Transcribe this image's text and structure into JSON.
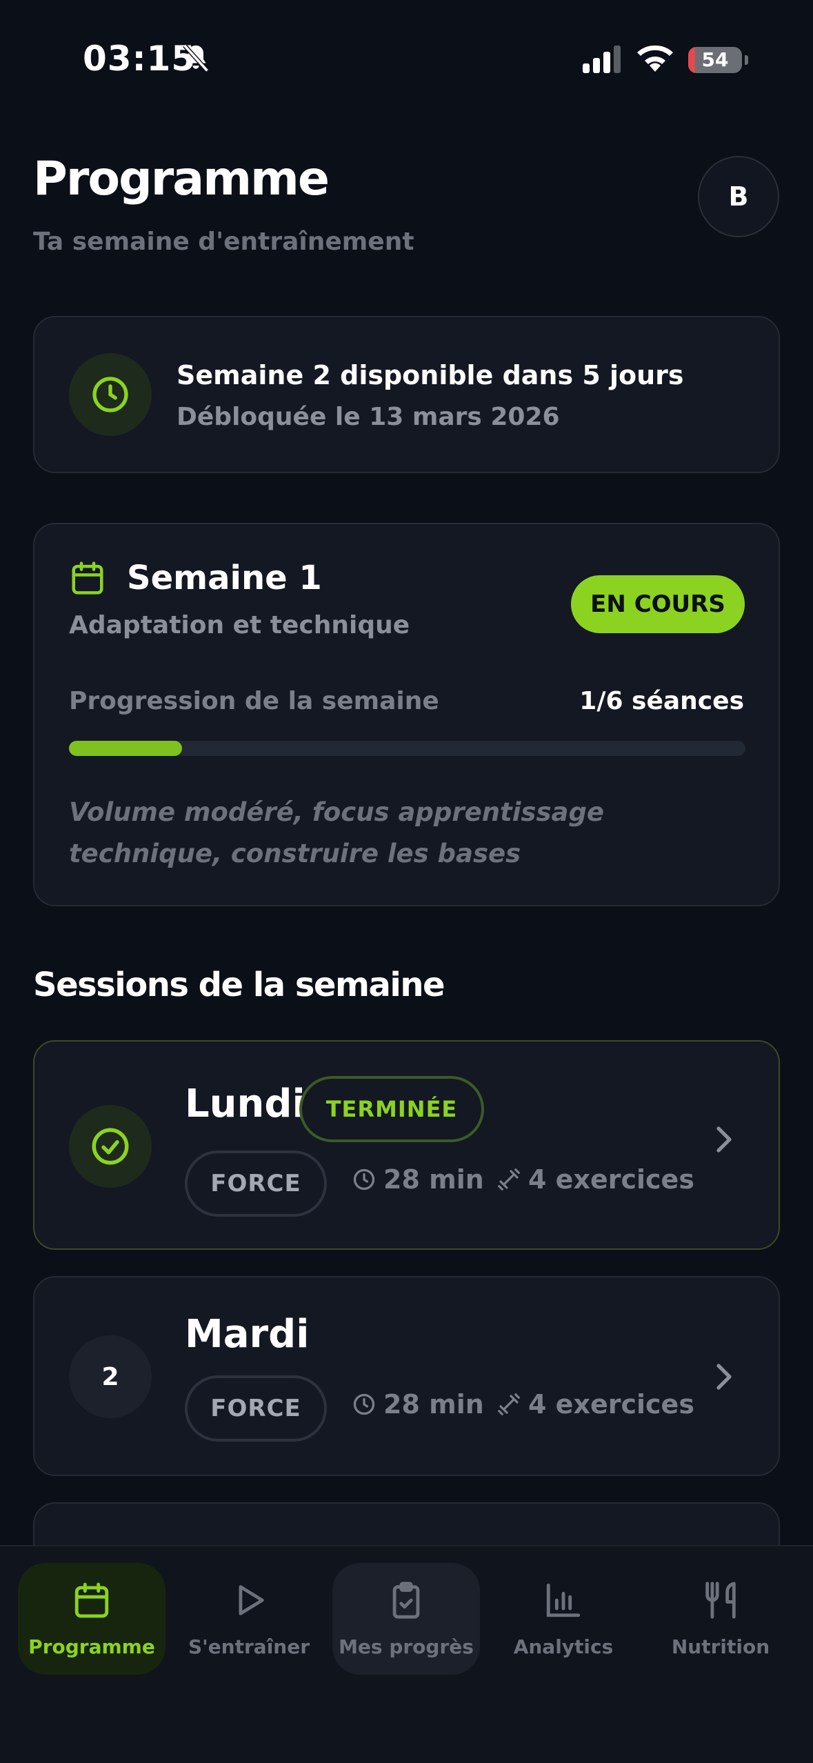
{
  "status_bar": {
    "time": "03:15",
    "battery": "54"
  },
  "header": {
    "title": "Programme",
    "subtitle": "Ta semaine d'entraînement",
    "avatar_initial": "B"
  },
  "unlock_card": {
    "title": "Semaine 2 disponible dans 5 jours",
    "date": "Débloquée le 13 mars 2026"
  },
  "week_card": {
    "title": "Semaine 1",
    "theme": "Adaptation et technique",
    "status": "EN COURS",
    "progress_label": "Progression de la semaine",
    "progress_count": "1/6 séances",
    "progress_fraction": 0.167,
    "description": "Volume modéré, focus apprentissage technique, construire les bases"
  },
  "sessions_title": "Sessions de la semaine",
  "sessions": [
    {
      "day": "Lundi",
      "status": "TERMINÉE",
      "type": "FORCE",
      "duration": "28 min",
      "exercises": "4 exercices"
    },
    {
      "day": "Mardi",
      "number": "2",
      "type": "FORCE",
      "duration": "28 min",
      "exercises": "4 exercices"
    }
  ],
  "tabs": [
    {
      "label": "Programme",
      "icon": "calendar-icon",
      "active": true
    },
    {
      "label": "S'entraîner",
      "icon": "play-icon"
    },
    {
      "label": "Mes progrès",
      "icon": "clipboard-check-icon"
    },
    {
      "label": "Analytics",
      "icon": "bar-chart-icon"
    },
    {
      "label": "Nutrition",
      "icon": "fork-knife-icon"
    }
  ],
  "colors": {
    "accent": "#8bd320",
    "background": "#0b0f17",
    "card": "#131823"
  }
}
